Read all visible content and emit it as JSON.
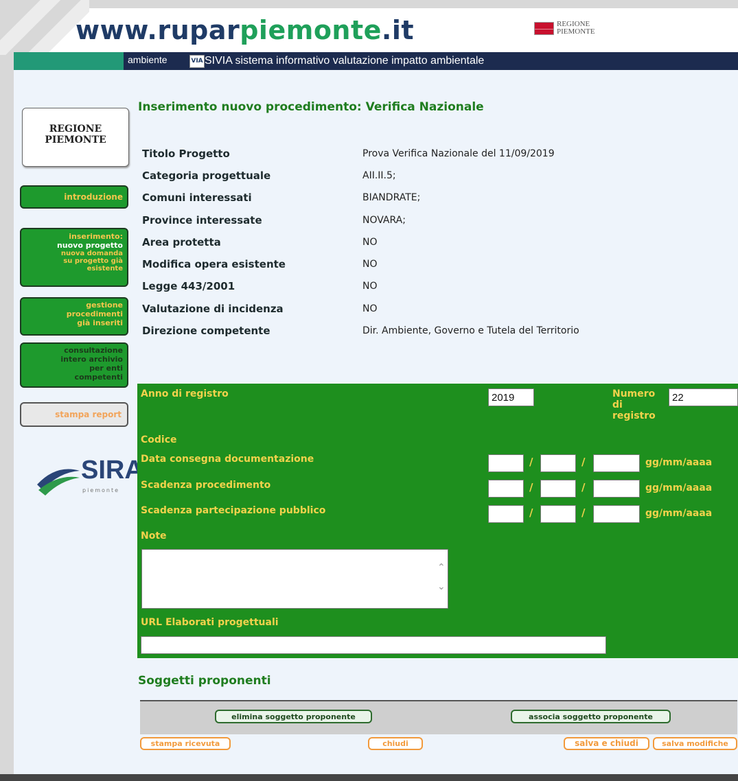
{
  "header": {
    "logo_www": "www.",
    "logo_rupar": "rupar",
    "logo_piemonte": "piemonte",
    "logo_it": ".it",
    "regione_line1": "REGIONE",
    "regione_line2": "PIEMONTE",
    "bar_label": "ambiente",
    "via_icon_text": "VIA",
    "bar_title": "SIVIA sistema informativo valutazione impatto ambientale"
  },
  "sidebar": {
    "regione_line1": "REGIONE",
    "regione_line2": "PIEMONTE",
    "introduzione": "introduzione",
    "inserimento_title": "inserimento:",
    "nuovo_progetto": "nuovo progetto",
    "nuova_domanda": "nuova domanda",
    "su_progetto": "su progetto già",
    "esistente": "esistente",
    "gestione_1": "gestione",
    "gestione_2": "procedimenti",
    "gestione_3": "già inseriti",
    "consult_1": "consultazione",
    "consult_2": "intero archivio",
    "consult_3": "per enti",
    "consult_4": "competenti",
    "stampa_report": "stampa report",
    "sira_text": "SIRA",
    "sira_sub": "piemonte"
  },
  "page": {
    "title": "Inserimento nuovo procedimento: Verifica Nazionale"
  },
  "info": [
    {
      "label": "Titolo Progetto",
      "value": "Prova Verifica Nazionale del 11/09/2019"
    },
    {
      "label": "Categoria progettuale",
      "value": "AII.II.5;"
    },
    {
      "label": "Comuni interessati",
      "value": "BIANDRATE;"
    },
    {
      "label": "Province interessate",
      "value": "NOVARA;"
    },
    {
      "label": "Area protetta",
      "value": "NO"
    },
    {
      "label": "Modifica opera esistente",
      "value": "NO"
    },
    {
      "label": "Legge 443/2001",
      "value": "NO"
    },
    {
      "label": "Valutazione di incidenza",
      "value": "NO"
    },
    {
      "label": "Direzione competente",
      "value": "Dir. Ambiente, Governo e Tutela del Territorio"
    }
  ],
  "form": {
    "anno_label": "Anno di registro",
    "anno_value": "2019",
    "numero_label_1": "Numero",
    "numero_label_2": "di",
    "numero_label_3": "registro",
    "numero_value": "22",
    "codice_label": "Codice",
    "data_consegna_label": "Data consegna documentazione",
    "scadenza_proc_label": "Scadenza procedimento",
    "scadenza_part_label": "Scadenza partecipazione pubblico",
    "date_sep": "/",
    "date_format": "gg/mm/aaaa",
    "note_label": "Note",
    "url_label": "URL Elaborati progettuali"
  },
  "soggetti": {
    "title": "Soggetti proponenti",
    "elimina": "elimina soggetto proponente",
    "associa": "associa soggetto proponente"
  },
  "actions": {
    "stampa_ricevuta": "stampa ricevuta",
    "chiudi": "chiudi",
    "salva_chiudi": "salva e chiudi",
    "salva_modifiche": "salva modifiche"
  }
}
